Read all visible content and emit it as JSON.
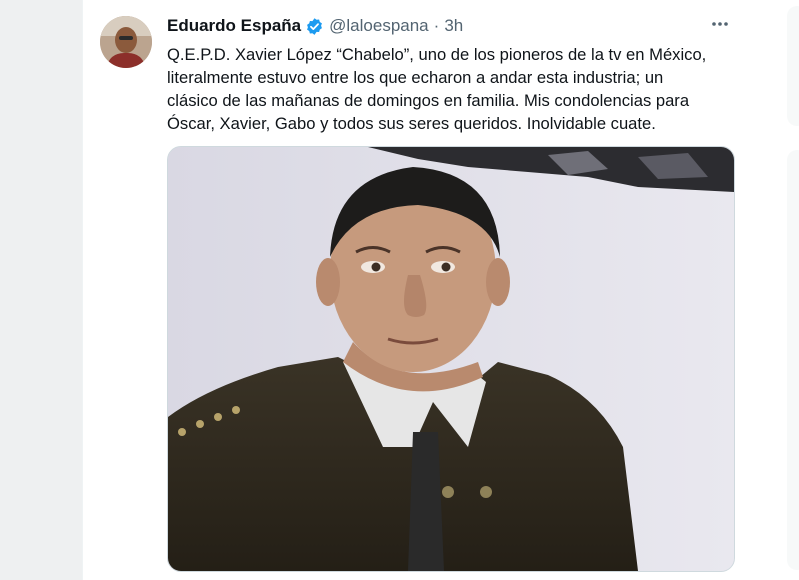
{
  "tweet": {
    "author_name": "Eduardo España",
    "handle": "@laloespana",
    "separator": "·",
    "time": "3h",
    "text_lines": [
      "Q.E.P.D. Xavier López “Chabelo”, uno de los pioneros de la tv en México,",
      "literalmente estuvo entre los que echaron a andar esta industria; un",
      "clásico de las mañanas de domingos en familia. Mis condolencias para",
      "Óscar, Xavier, Gabo y todos sus seres queridos. Inolvidable cuate."
    ]
  },
  "icons": {
    "verified": "verified-badge-icon",
    "more": "more-options-icon"
  },
  "colors": {
    "text": "#0f1419",
    "secondary": "#536471",
    "verified": "#1d9bf0",
    "border": "#cfd9de"
  }
}
